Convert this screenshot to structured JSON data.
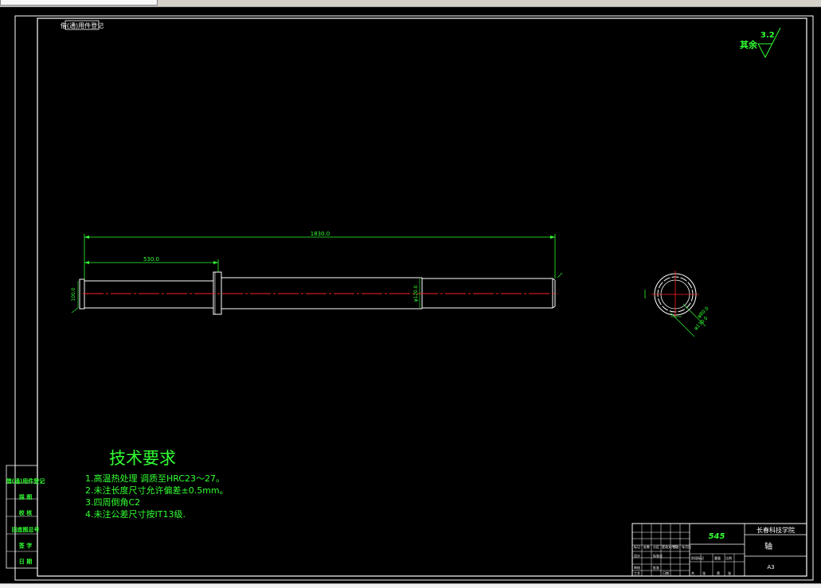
{
  "tabs": {
    "active_label": ""
  },
  "drawing": {
    "surface_finish": {
      "label": "其余",
      "value": "3.2"
    },
    "top_left_stamp": "借(通)用件登记",
    "dims": {
      "overall_length": "1830.0",
      "step_length": "530.0",
      "left_end_dia": "100.0",
      "mid_dia": "φ120.0",
      "section_inner": "φ80.0",
      "section_outer": "φ130.0"
    },
    "tech_requirements": {
      "title": "技术要求",
      "items": [
        "1.高温热处理 调质至HRC23～27。",
        "2.未注长度尺寸允许偏差±0.5mm。",
        "3.四周倒角C2",
        "4.未注公差尺寸按IT13级."
      ]
    },
    "left_column": [
      "借(通)用件登记",
      "描 图",
      "校 核",
      "旧底图总号",
      "签 字",
      "日 期"
    ],
    "title_block": {
      "material": "545",
      "institute": "长春科技学院",
      "part_name": "轴",
      "sheet_size": "A3",
      "small_labels": [
        "标记",
        "处数",
        "分区",
        "更改文件号",
        "签名",
        "年月日",
        "设计",
        "审核",
        "工艺",
        "日期",
        "标准化",
        "批准",
        "阶段标记",
        "重量",
        "比例",
        "共",
        "张",
        "第",
        "张"
      ]
    }
  },
  "colors": {
    "background": "#000000",
    "outline": "#ffffff",
    "centerline": "#ff2020",
    "annotation": "#32ff32"
  }
}
